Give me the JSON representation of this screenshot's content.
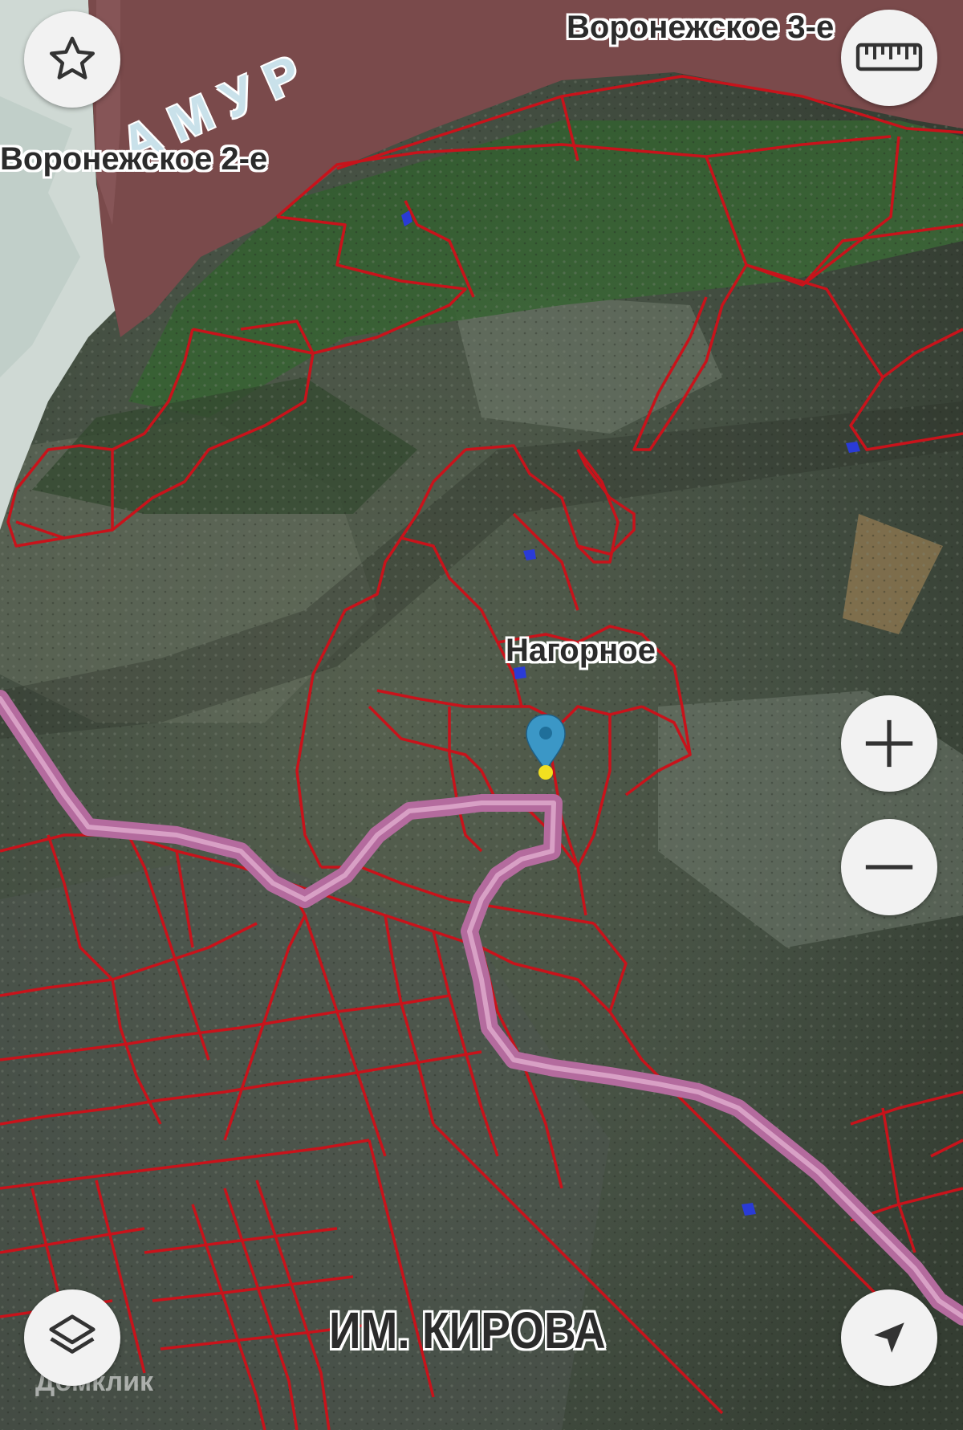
{
  "map": {
    "water_label": "АМУР",
    "places": {
      "voronezhskoe_2": "Воронежское 2-е",
      "voronezhskoe_3": "Воронежское 3-е",
      "nagornoe": "Нагорное",
      "im_kirova": "ИМ. КИРОВА"
    },
    "watermark": "Домклик",
    "colors": {
      "parcel_boundary": "#c8131b",
      "route": "#b46b9e",
      "river": "#7a4a4b",
      "pin": "#3b97c6",
      "pin_dot": "#f2e020"
    }
  },
  "controls": {
    "favorite_icon": "star-icon",
    "ruler_icon": "ruler-icon",
    "zoom_in_icon": "plus-icon",
    "zoom_out_icon": "minus-icon",
    "layers_icon": "layers-icon",
    "locate_icon": "navigation-arrow-icon"
  }
}
